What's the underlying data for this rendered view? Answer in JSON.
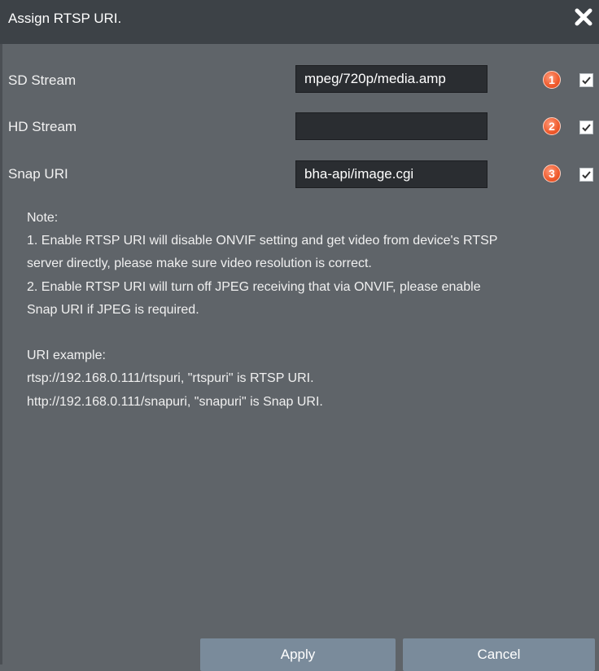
{
  "dialog": {
    "title": "Assign RTSP URI.",
    "close_icon": "close-icon"
  },
  "rows": [
    {
      "label": "SD Stream",
      "value": "mpeg/720p/media.amp",
      "badge": "1",
      "checked": true
    },
    {
      "label": "HD Stream",
      "value": "",
      "badge": "2",
      "checked": true
    },
    {
      "label": "Snap URI",
      "value": "bha-api/image.cgi",
      "badge": "3",
      "checked": true
    }
  ],
  "note": {
    "lines": [
      "Note:",
      "1. Enable RTSP URI will disable ONVIF setting and get video from device's RTSP",
      "server directly, please make sure video resolution is correct.",
      "2. Enable RTSP URI will turn off JPEG receiving that via ONVIF, please enable",
      "Snap URI if JPEG is required.",
      "",
      "URI example:",
      "rtsp://192.168.0.111/rtspuri, \"rtspuri\" is RTSP URI.",
      "http://192.168.0.111/snapuri, \"snapuri\" is Snap URI."
    ]
  },
  "buttons": {
    "apply": "Apply",
    "cancel": "Cancel"
  },
  "colors": {
    "title_bar": "#3d4247",
    "body": "#5f6469",
    "input_bg": "#2a2d31",
    "badge": "#ef5a2c",
    "button": "#7a8b9b"
  }
}
